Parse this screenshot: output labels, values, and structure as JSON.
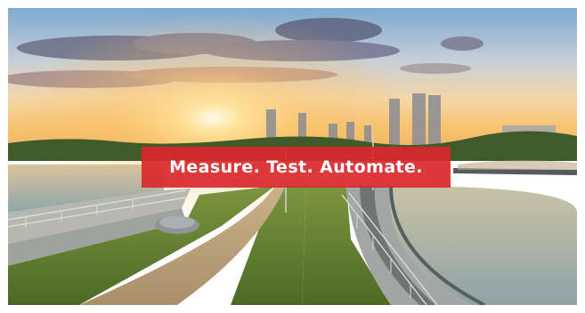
{
  "banner": {
    "headline": "Measure. Test. Automate."
  },
  "scene": {
    "subject": "water treatment plant at sunset",
    "colors": {
      "banner_red": "#da282d",
      "sky_top": "#7fa9cf",
      "sun_glow": "#ffd27a",
      "grass": "#5b7d2c",
      "water": "#9fb2b7"
    }
  }
}
